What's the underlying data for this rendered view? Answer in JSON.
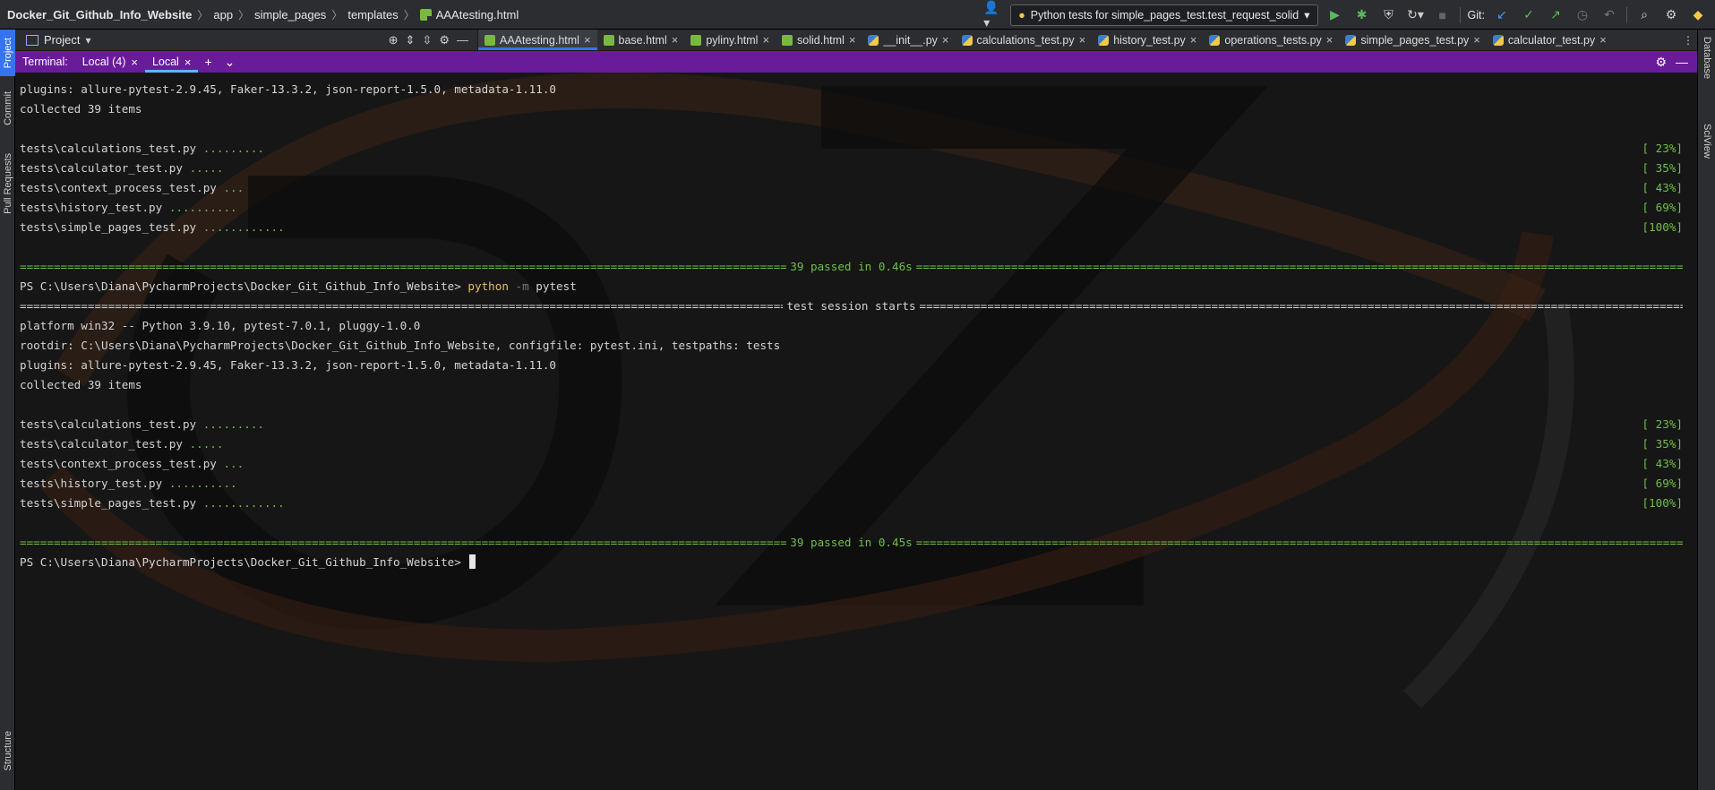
{
  "navbar": {
    "breadcrumb": [
      "Docker_Git_Github_Info_Website",
      "app",
      "simple_pages",
      "templates",
      "AAAtesting.html"
    ],
    "run_config": "Python tests for simple_pages_test.test_request_solid",
    "git_label": "Git:"
  },
  "left_strip": {
    "project": "Project",
    "commit": "Commit",
    "pull_requests": "Pull Requests",
    "structure": "Structure"
  },
  "right_strip": {
    "database": "Database",
    "sciview": "SciView"
  },
  "project_panel": {
    "label": "Project"
  },
  "editor_tabs": [
    {
      "label": "AAAtesting.html",
      "type": "html",
      "active": true
    },
    {
      "label": "base.html",
      "type": "html"
    },
    {
      "label": "pyliny.html",
      "type": "html"
    },
    {
      "label": "solid.html",
      "type": "html"
    },
    {
      "label": "__init__.py",
      "type": "py"
    },
    {
      "label": "calculations_test.py",
      "type": "py"
    },
    {
      "label": "history_test.py",
      "type": "py"
    },
    {
      "label": "operations_tests.py",
      "type": "py"
    },
    {
      "label": "simple_pages_test.py",
      "type": "py"
    },
    {
      "label": "calculator_test.py",
      "type": "py"
    }
  ],
  "terminal": {
    "title": "Terminal:",
    "tabs": [
      "Local (4)",
      "Local"
    ],
    "add": "+",
    "lines": {
      "l1": "plugins: allure-pytest-2.9.45, Faker-13.3.2, json-report-1.5.0, metadata-1.11.0",
      "l2": "collected 39 items",
      "r1a": "tests\\calculations_test.py ",
      "r1b": ".........",
      "r1p": "[ 23%]",
      "r2a": "tests\\calculator_test.py ",
      "r2b": ".....",
      "r2p": "[ 35%]",
      "r3a": "tests\\context_process_test.py ",
      "r3b": "...",
      "r3p": "[ 43%]",
      "r4a": "tests\\history_test.py ",
      "r4b": "..........",
      "r4p": "[ 69%]",
      "r5a": "tests\\simple_pages_test.py ",
      "r5b": "............",
      "r5p": "[100%]",
      "sum1": "39 passed in 0.46s",
      "prompt1": "PS C:\\Users\\Diana\\PycharmProjects\\Docker_Git_Github_Info_Website> ",
      "cmd_py": "python",
      "cmd_flag": "-m",
      "cmd_rest": "pytest",
      "session": "test session starts",
      "platform": "platform win32 -- Python 3.9.10, pytest-7.0.1, pluggy-1.0.0",
      "rootdir": "rootdir: C:\\Users\\Diana\\PycharmProjects\\Docker_Git_Github_Info_Website, configfile: pytest.ini, testpaths: tests",
      "plugins2": "plugins: allure-pytest-2.9.45, Faker-13.3.2, json-report-1.5.0, metadata-1.11.0",
      "collected2": "collected 39 items",
      "sum2": "39 passed in 0.45s",
      "prompt2": "PS C:\\Users\\Diana\\PycharmProjects\\Docker_Git_Github_Info_Website> "
    }
  },
  "colors": {
    "terminal_bar": "#6a1b9a",
    "pass_green": "#6fbf4a",
    "accent": "#3574f0"
  }
}
